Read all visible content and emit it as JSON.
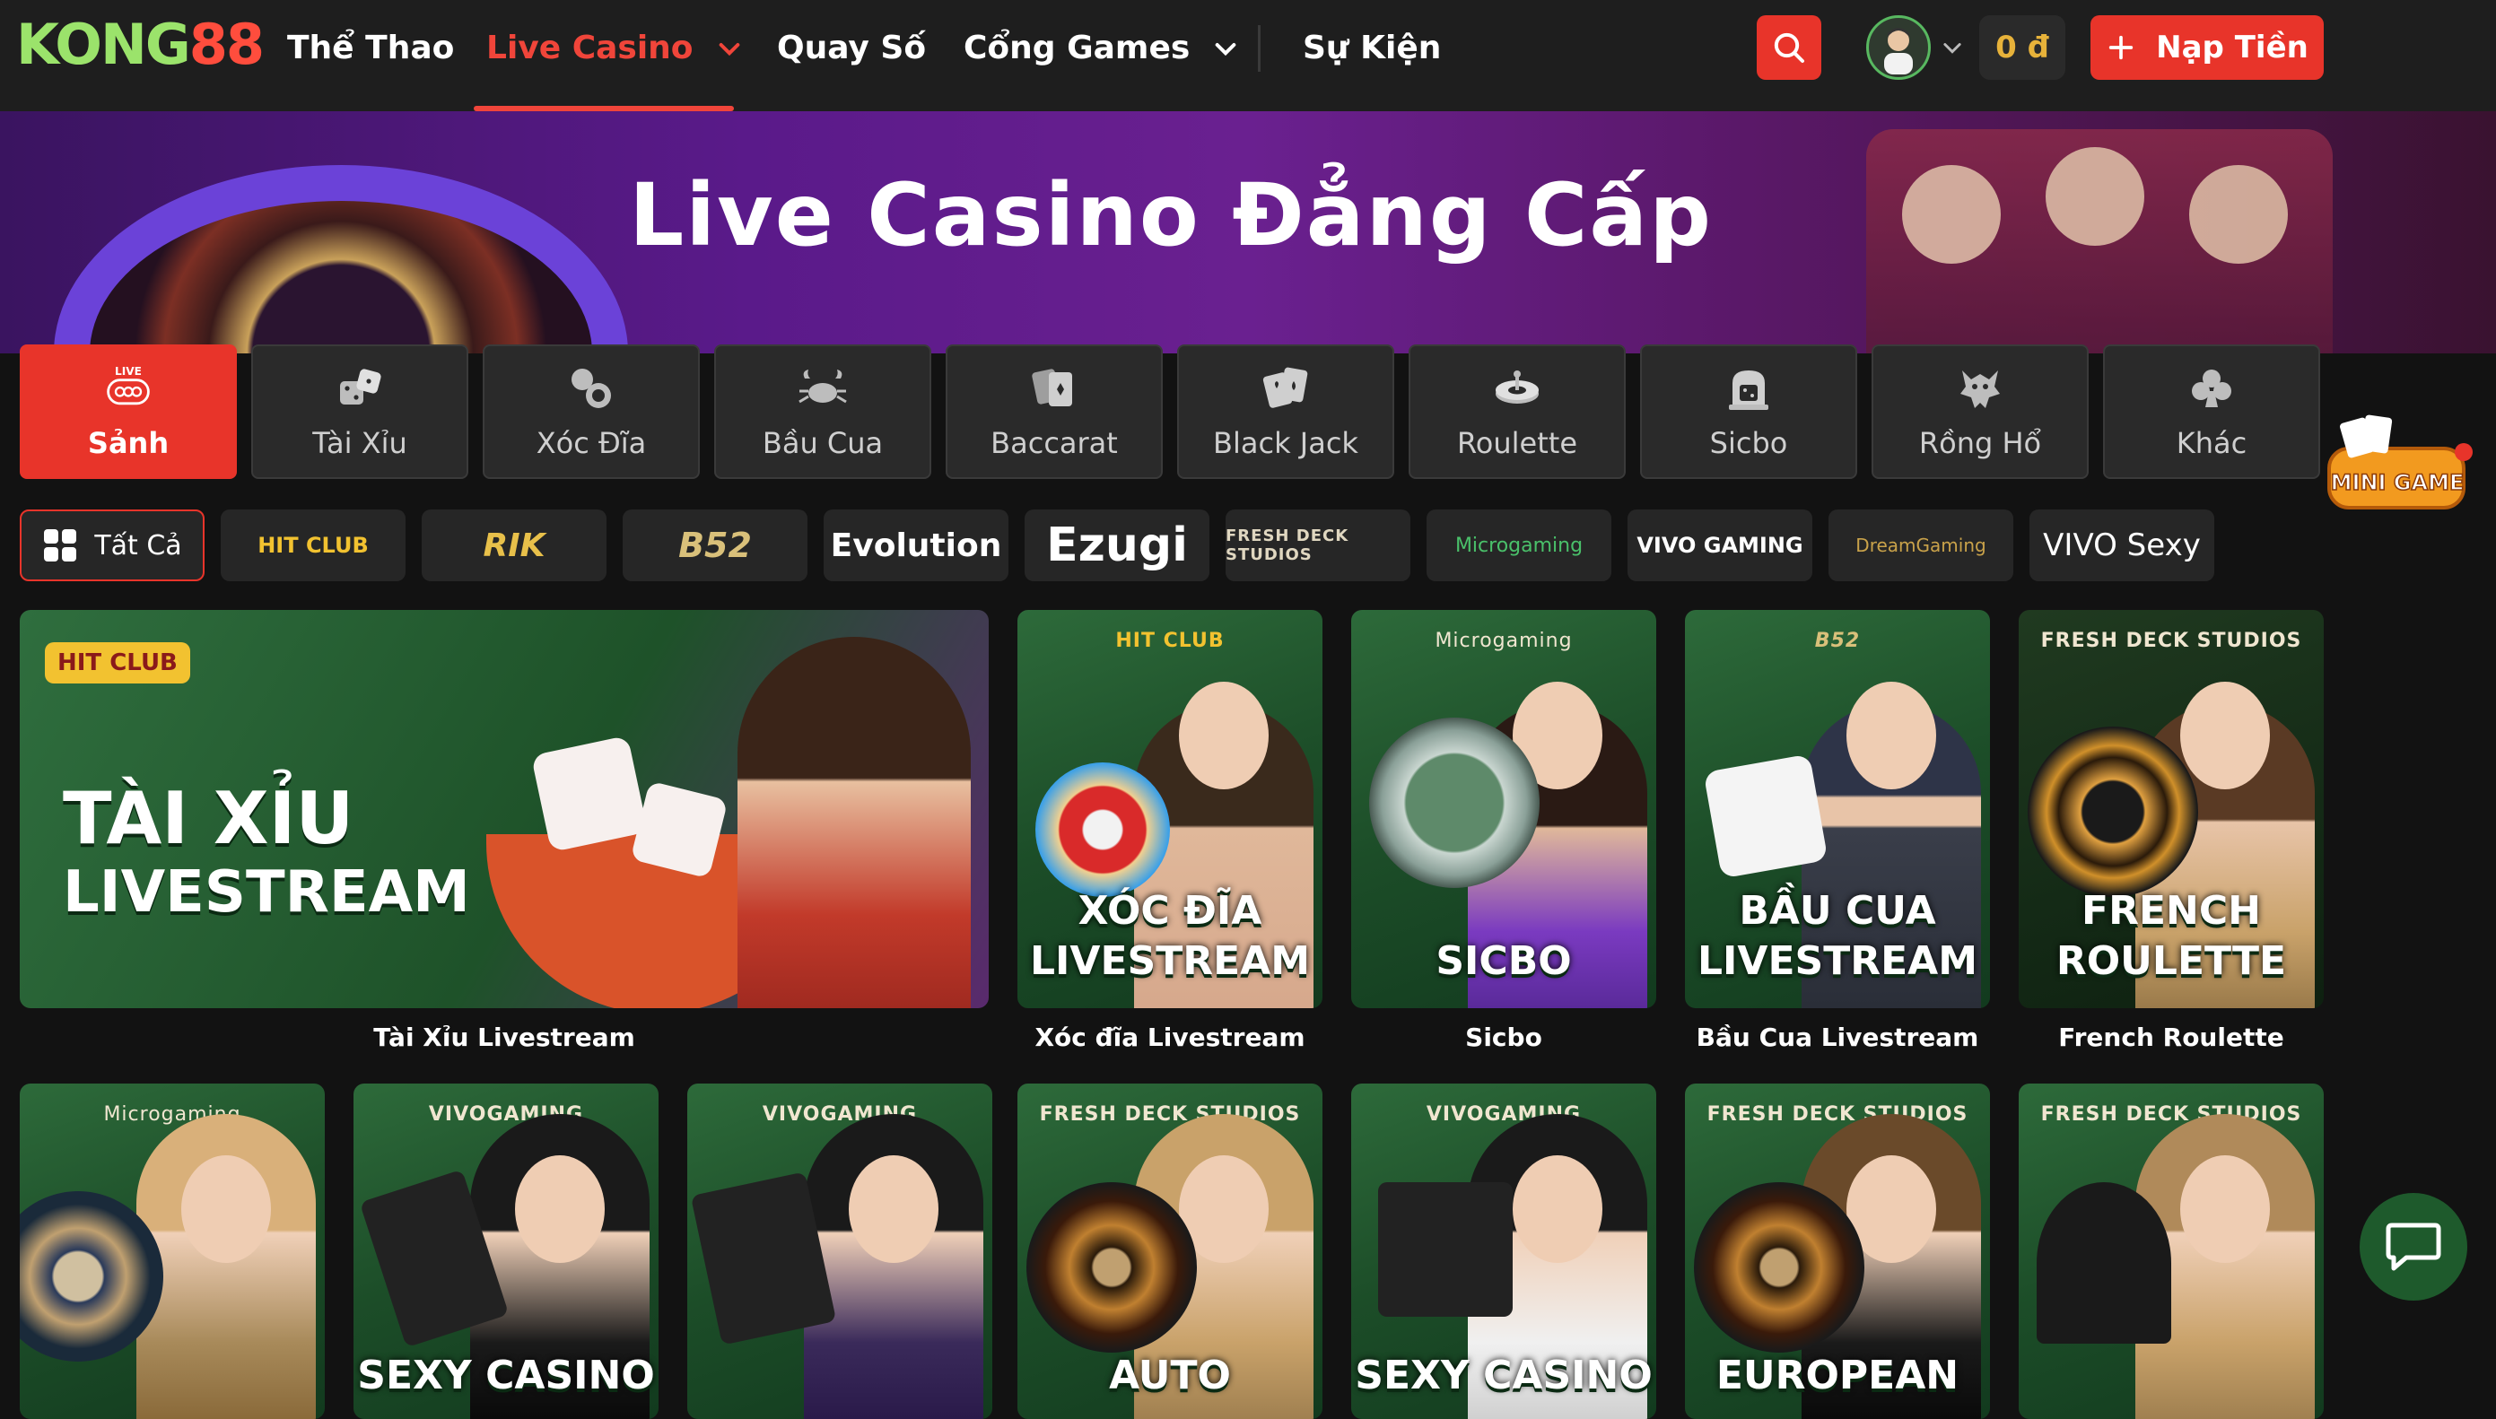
{
  "header": {
    "logo_part1": "KONG",
    "logo_part2": "88",
    "nav": [
      "Thể Thao",
      "Live Casino",
      "Quay Số",
      "Cổng Games",
      "Sự Kiện"
    ],
    "balance": "0 đ",
    "deposit_label": "Nạp Tiền",
    "accent": "#e8342a"
  },
  "banner": {
    "title": "Live Casino Đẳng Cấp"
  },
  "categories": [
    {
      "label": "Sảnh",
      "badge": "LIVE",
      "icon": "live-icon"
    },
    {
      "label": "Tài Xỉu",
      "icon": "dice-icon"
    },
    {
      "label": "Xóc Đĩa",
      "icon": "coins-icon"
    },
    {
      "label": "Bầu Cua",
      "icon": "crab-icon"
    },
    {
      "label": "Baccarat",
      "icon": "cards-icon"
    },
    {
      "label": "Black Jack",
      "icon": "blackjack-icon"
    },
    {
      "label": "Roulette",
      "icon": "roulette-icon"
    },
    {
      "label": "Sicbo",
      "icon": "sicbo-icon"
    },
    {
      "label": "Rồng Hổ",
      "icon": "dragon-icon"
    },
    {
      "label": "Khác",
      "icon": "club-icon"
    }
  ],
  "mini_game": "MINI GAME",
  "providers": {
    "all_label": "Tất Cả",
    "items": [
      "HIT CLUB",
      "RIK",
      "B52",
      "Evolution",
      "Ezugi",
      "FRESH DECK STUDIOS",
      "Microgaming",
      "VIVO GAMING",
      "DreamGaming",
      "VIVO Sexy"
    ]
  },
  "games_row1": [
    {
      "provider": "HIT CLUB",
      "title_line1": "TÀI XỈU",
      "title_line2": "LIVESTREAM",
      "name": "Tài Xỉu Livestream"
    },
    {
      "provider": "HIT CLUB",
      "title_line1": "XÓC ĐĨA",
      "title_line2": "LIVESTREAM",
      "name": "Xóc đĩa Livestream"
    },
    {
      "provider": "Microgaming",
      "title_line1": "",
      "title_line2": "SICBO",
      "name": "Sicbo"
    },
    {
      "provider": "B52",
      "title_line1": "BẦU CUA",
      "title_line2": "LIVESTREAM",
      "name": "Bầu Cua Livestream"
    },
    {
      "provider": "FRESH DECK STUDIOS",
      "title_line1": "FRENCH",
      "title_line2": "ROULETTE",
      "name": "French Roulette"
    }
  ],
  "games_row2": [
    {
      "provider": "Microgaming",
      "title": ""
    },
    {
      "provider": "VIVOGAMING",
      "title": "SEXY CASINO"
    },
    {
      "provider": "VIVOGAMING",
      "title": ""
    },
    {
      "provider": "FRESH DECK STUDIOS",
      "title": "AUTO"
    },
    {
      "provider": "VIVOGAMING",
      "title": "SEXY CASINO"
    },
    {
      "provider": "FRESH DECK STUDIOS",
      "title": "EUROPEAN"
    },
    {
      "provider": "FRESH DECK STUDIOS",
      "title": ""
    }
  ]
}
